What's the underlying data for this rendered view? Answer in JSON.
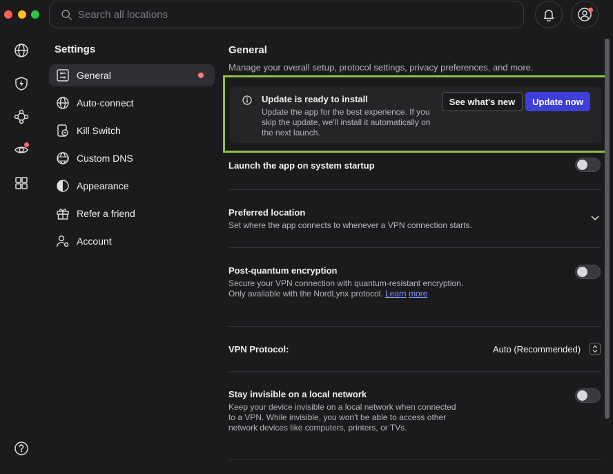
{
  "search": {
    "placeholder": "Search all locations"
  },
  "sidebar": {
    "title": "Settings",
    "items": [
      {
        "label": "General",
        "active": true,
        "badge": true
      },
      {
        "label": "Auto-connect"
      },
      {
        "label": "Kill Switch"
      },
      {
        "label": "Custom DNS"
      },
      {
        "label": "Appearance"
      },
      {
        "label": "Refer a friend"
      },
      {
        "label": "Account"
      }
    ]
  },
  "main": {
    "title": "General",
    "description": "Manage your overall setup, protocol settings, privacy preferences, and more.",
    "update_card": {
      "title": "Update is ready to install",
      "text": "Update the app for the best experience. If you skip the update, we'll install it automatically on the next launch.",
      "secondary_button": "See what's new",
      "primary_button": "Update now"
    },
    "settings": [
      {
        "title": "Launch the app on system startup",
        "toggle_on": false
      },
      {
        "title": "Preferred location",
        "description": "Set where the app connects to whenever a VPN connection starts."
      },
      {
        "title": "Post-quantum encryption",
        "description": "Secure your VPN connection with quantum-resistant encryption. Only available with the NordLynx protocol.",
        "link_a": "Learn",
        "link_b": "more",
        "toggle_on": false
      },
      {
        "title": "VPN Protocol:",
        "value": "Auto (Recommended)"
      },
      {
        "title": "Stay invisible on a local network",
        "description": "Keep your device invisible on a local network when connected to a VPN. While invisible, you won't be able to access other network devices like computers, printers, or TVs.",
        "toggle_on": false
      }
    ]
  },
  "colors": {
    "accent": "#3d3fd8",
    "highlight_border": "#8bc34a",
    "badge": "#f17e84"
  }
}
